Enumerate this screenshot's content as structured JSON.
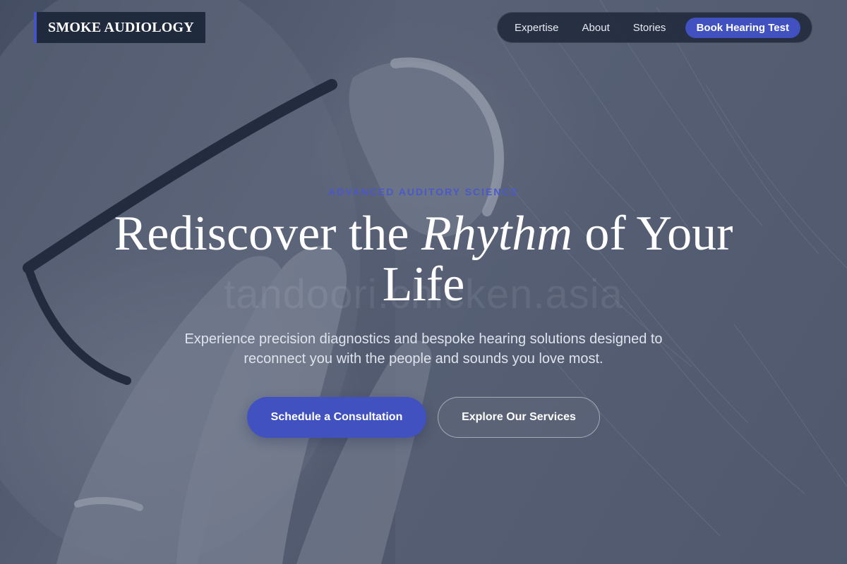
{
  "brand": {
    "name": "SMOKE AUDIOLOGY"
  },
  "nav": {
    "links": [
      "Expertise",
      "About",
      "Stories"
    ],
    "cta_label": "Book Hearing Test"
  },
  "hero": {
    "eyebrow": "ADVANCED AUDITORY SCIENCE",
    "headline_before": "Rediscover the ",
    "headline_emphasis": "Rhythm",
    "headline_after": " of Your Life",
    "watermark": "tandoori.chicken.asia",
    "subtitle": "Experience precision diagnostics and bespoke hearing solutions designed to reconnect you with the people and sounds you love most.",
    "primary_button": "Schedule a Consultation",
    "secondary_button": "Explore Our Services",
    "background_image": "Close-up grayscale photo of a person fitting a behind-the-ear hearing aid, wearing glasses"
  },
  "colors": {
    "accent": "#4151c0",
    "header_bg": "#1f2a3d",
    "overlay": "#343e5c"
  }
}
